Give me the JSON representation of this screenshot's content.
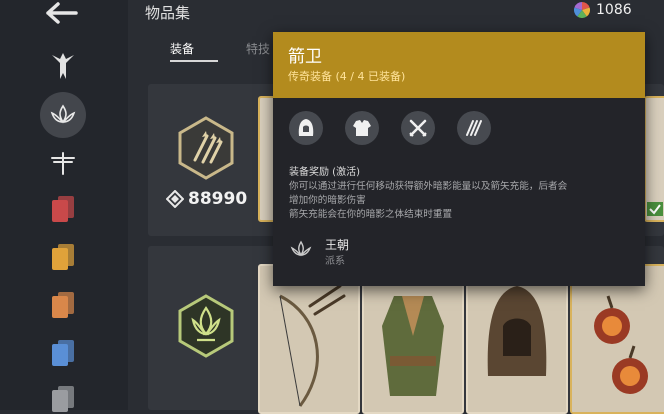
{
  "header": {
    "title": "物品集",
    "currency_value": "1086"
  },
  "tabs": [
    {
      "label": "装备",
      "active": true
    },
    {
      "label": "特技",
      "active": false
    }
  ],
  "sets": [
    {
      "points": "88990"
    }
  ],
  "sidebar": {
    "swatch_colors": [
      "#c9494a",
      "#e0a23a",
      "#d9874a",
      "#5a8fd6",
      "#9a9ca0"
    ]
  },
  "tooltip": {
    "name": "箭卫",
    "subtitle": "传奇装备 (4 / 4 已装备)",
    "bonus_title": "装备奖励 (激活)",
    "desc_line1": "你可以通过进行任何移动获得额外暗影能量以及箭矢充能，后者会",
    "desc_line2": "增加你的暗影伤害",
    "desc_line3": "箭矢充能会在你的暗影之体结束时重置",
    "faction_name": "王朝",
    "faction_type": "派系"
  },
  "colors": {
    "accent_gold": "#b38b1e",
    "bg": "#2a2d33"
  }
}
